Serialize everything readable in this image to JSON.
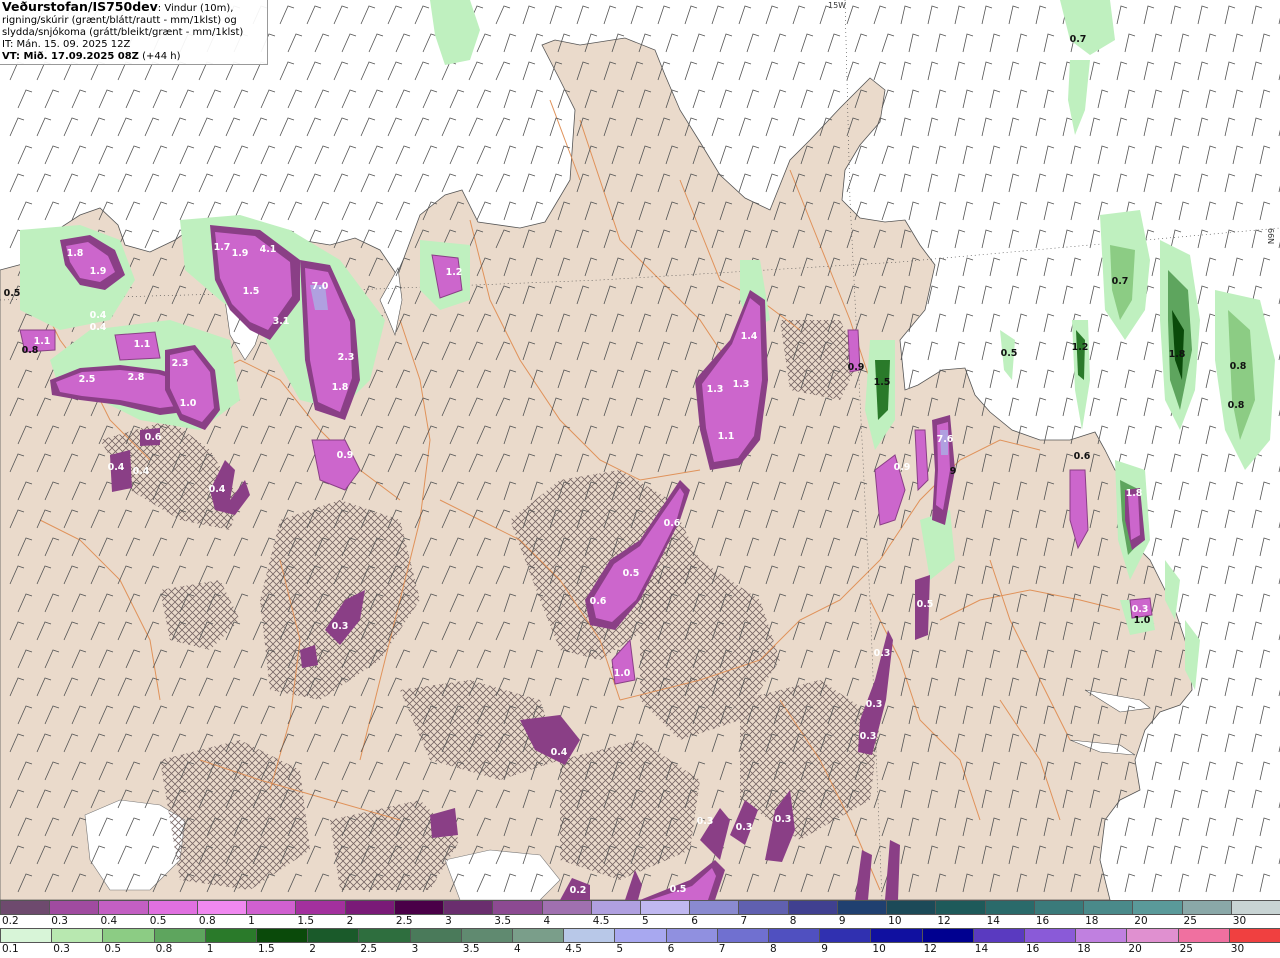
{
  "title": {
    "producer": "Veðurstofan/IS750dev",
    "variable_line1": ": Vindur (10m),",
    "variable_line2": "rigning/skúrir (grænt/blátt/rautt - mm/1klst) og",
    "variable_line3": "slydda/snjókoma (grátt/bleikt/grænt - mm/1klst)",
    "init_time": "IT: Mán. 15. 09. 2025 12Z",
    "valid_label": "VT: Mið. 17.09.2025 08Z",
    "lead": "(+44 h)"
  },
  "grid_labels": {
    "longitude": "15W",
    "latitude": "66N"
  },
  "colors": {
    "land": "#eadacb",
    "sea": "#ffffff",
    "boundaries": "#e0925a",
    "hatch": "#6b5a5a",
    "snow_light": "#cc66cc",
    "snow_heavy": "#8a3f86",
    "rain_green": "#5ea55e",
    "rain_light": "#bff0bf"
  },
  "precip_labels": [
    {
      "text": "1.8",
      "dark": false
    },
    {
      "text": "1.9",
      "dark": false
    },
    {
      "text": "0.5",
      "dark": true
    },
    {
      "text": "0.4",
      "dark": false
    },
    {
      "text": "0.4",
      "dark": false
    },
    {
      "text": "1.1",
      "dark": false
    },
    {
      "text": "0.8",
      "dark": true
    },
    {
      "text": "1.1",
      "dark": false
    },
    {
      "text": "2.5",
      "dark": false
    },
    {
      "text": "2.8",
      "dark": false
    },
    {
      "text": "2.3",
      "dark": false
    },
    {
      "text": "1.0",
      "dark": false
    },
    {
      "text": "0.6",
      "dark": false
    },
    {
      "text": "0.4",
      "dark": false
    },
    {
      "text": "0.4",
      "dark": false
    },
    {
      "text": "1.7",
      "dark": false
    },
    {
      "text": "1.9",
      "dark": false
    },
    {
      "text": "4.1",
      "dark": false
    },
    {
      "text": "1.5",
      "dark": false
    },
    {
      "text": "3.1",
      "dark": false
    },
    {
      "text": "7.0",
      "dark": false
    },
    {
      "text": "2.3",
      "dark": false
    },
    {
      "text": "1.8",
      "dark": false
    },
    {
      "text": "0.9",
      "dark": false
    },
    {
      "text": "1.2",
      "dark": false
    },
    {
      "text": "1.4",
      "dark": false
    },
    {
      "text": "1.3",
      "dark": false
    },
    {
      "text": "1.3",
      "dark": false
    },
    {
      "text": "1.1",
      "dark": false
    },
    {
      "text": "0.5",
      "dark": false
    },
    {
      "text": "0.6",
      "dark": false
    },
    {
      "text": "0.6",
      "dark": false
    },
    {
      "text": "1.0",
      "dark": false
    },
    {
      "text": "0.4",
      "dark": false
    },
    {
      "text": "0.4",
      "dark": false
    },
    {
      "text": "0.3",
      "dark": false
    },
    {
      "text": "0.2",
      "dark": false
    },
    {
      "text": "0.5",
      "dark": false
    },
    {
      "text": "0.3",
      "dark": false
    },
    {
      "text": "0.3",
      "dark": false
    },
    {
      "text": "0.3",
      "dark": false
    },
    {
      "text": "0.9",
      "dark": true
    },
    {
      "text": "1.5",
      "dark": true
    },
    {
      "text": "0.9",
      "dark": false
    },
    {
      "text": "7.6",
      "dark": false
    },
    {
      "text": "9",
      "dark": true
    },
    {
      "text": "0.5",
      "dark": false
    },
    {
      "text": "0.3",
      "dark": false
    },
    {
      "text": "0.3",
      "dark": false
    },
    {
      "text": "0.3",
      "dark": false
    },
    {
      "text": "0.7",
      "dark": true
    },
    {
      "text": "0.7",
      "dark": true
    },
    {
      "text": "1.2",
      "dark": true
    },
    {
      "text": "1.8",
      "dark": true
    },
    {
      "text": "0.8",
      "dark": true
    },
    {
      "text": "0.8",
      "dark": true
    },
    {
      "text": "0.5",
      "dark": true
    },
    {
      "text": "0.6",
      "dark": true
    },
    {
      "text": "1.8",
      "dark": false
    },
    {
      "text": "0.3",
      "dark": false
    },
    {
      "text": "1.0",
      "dark": true
    }
  ],
  "colorbar_top": {
    "ticks": [
      "0.2",
      "0.3",
      "0.4",
      "0.5",
      "0.8",
      "1",
      "1.5",
      "2",
      "2.5",
      "3",
      "3.5",
      "4",
      "4.5",
      "5",
      "6",
      "7",
      "8",
      "9",
      "10",
      "12",
      "14",
      "16",
      "18",
      "20",
      "25",
      "30"
    ],
    "colors": [
      "#6e4a6e",
      "#a04ba0",
      "#c35fc3",
      "#e070e0",
      "#f088f0",
      "#d060d0",
      "#a3309e",
      "#7a1a78",
      "#4a0048",
      "#6a2e6e",
      "#8c4a92",
      "#a070b0",
      "#b0a0e0",
      "#c0b8f0",
      "#8a8ad0",
      "#6060b0",
      "#404090",
      "#204070",
      "#1c4a58",
      "#1e5a5a",
      "#2a6a6a",
      "#3a7a7a",
      "#4a8a8a",
      "#5a9a9a",
      "#8aa8a8",
      "#c8d4d4"
    ]
  },
  "colorbar_bottom": {
    "ticks": [
      "0.1",
      "0.3",
      "0.5",
      "0.8",
      "1",
      "1.5",
      "2",
      "2.5",
      "3",
      "3.5",
      "4",
      "4.5",
      "5",
      "6",
      "7",
      "8",
      "9",
      "10",
      "12",
      "14",
      "16",
      "18",
      "20",
      "25",
      "30"
    ],
    "colors": [
      "#d8f5d8",
      "#b8e8b0",
      "#8ccc84",
      "#5ea55e",
      "#2a7a2a",
      "#0a4a0a",
      "#1a5a2a",
      "#2e6e3e",
      "#4a7a5a",
      "#608a70",
      "#7a9e8a",
      "#b8c8e8",
      "#a8a8f0",
      "#9090e0",
      "#7070d0",
      "#5050c0",
      "#3030b0",
      "#1010a0",
      "#000090",
      "#5a3ac0",
      "#8a5ad8",
      "#c080e0",
      "#e090d0",
      "#f070a0",
      "#f04040"
    ]
  }
}
